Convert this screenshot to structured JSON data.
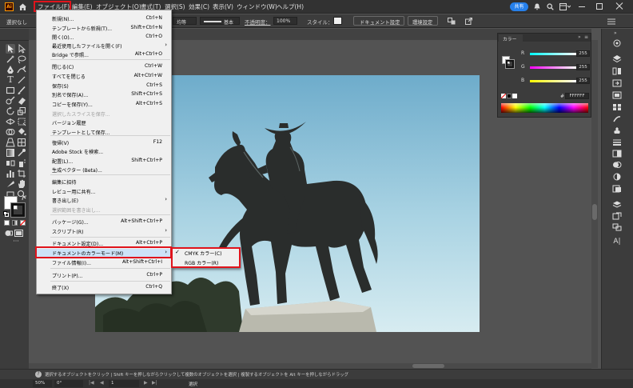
{
  "menubar": {
    "items": [
      "ファイル(F)",
      "編集(E)",
      "オブジェクト(O)",
      "書式(T)",
      "選択(S)",
      "効果(C)",
      "表示(V)",
      "ウィンドウ(W)",
      "ヘルプ(H)"
    ],
    "share_label": "共有"
  },
  "control_bar": {
    "selection_label": "選択なし",
    "stroke_profile": "均等",
    "brush_label": "基本",
    "opacity_label": "不透明度：",
    "opacity_value": "100%",
    "style_label": "スタイル：",
    "document_setup_button": "ドキュメント設定",
    "preferences_button": "環境設定"
  },
  "file_menu": {
    "items": [
      {
        "label": "新規(N)...",
        "shortcut": "Ctrl+N"
      },
      {
        "label": "テンプレートから新規(T)...",
        "shortcut": "Shift+Ctrl+N"
      },
      {
        "label": "開く(O)...",
        "shortcut": "Ctrl+O"
      },
      {
        "label": "最近使用したファイルを開く(F)",
        "shortcut": ""
      },
      {
        "label": "Bridge で参照...",
        "shortcut": "Alt+Ctrl+O"
      },
      {
        "label": "閉じる(C)",
        "shortcut": "Ctrl+W"
      },
      {
        "label": "すべてを閉じる",
        "shortcut": "Alt+Ctrl+W"
      },
      {
        "label": "保存(S)",
        "shortcut": "Ctrl+S"
      },
      {
        "label": "別名で保存(A)...",
        "shortcut": "Shift+Ctrl+S"
      },
      {
        "label": "コピーを保存(Y)...",
        "shortcut": "Alt+Ctrl+S"
      },
      {
        "label": "選択したスライスを保存...",
        "shortcut": ""
      },
      {
        "label": "バージョン履歴",
        "shortcut": ""
      },
      {
        "label": "テンプレートとして保存...",
        "shortcut": ""
      },
      {
        "label": "復帰(V)",
        "shortcut": "F12"
      },
      {
        "label": "Adobe Stock を検索...",
        "shortcut": ""
      },
      {
        "label": "配置(L)...",
        "shortcut": "Shift+Ctrl+P"
      },
      {
        "label": "生成ベクター (Beta)...",
        "shortcut": ""
      },
      {
        "label": "編集に招待",
        "shortcut": ""
      },
      {
        "label": "レビュー用に共有...",
        "shortcut": ""
      },
      {
        "label": "書き出し(E)",
        "shortcut": ""
      },
      {
        "label": "選択範囲を書き出し...",
        "shortcut": ""
      },
      {
        "label": "パッケージ(G)...",
        "shortcut": "Alt+Shift+Ctrl+P"
      },
      {
        "label": "スクリプト(R)",
        "shortcut": ""
      },
      {
        "label": "ドキュメント設定(D)...",
        "shortcut": "Alt+Ctrl+P"
      },
      {
        "label": "ドキュメントのカラーモード(M)",
        "shortcut": ""
      },
      {
        "label": "ファイル情報(I)...",
        "shortcut": "Alt+Shift+Ctrl+I"
      },
      {
        "label": "プリント(P)...",
        "shortcut": "Ctrl+P"
      },
      {
        "label": "終了(X)",
        "shortcut": "Ctrl+Q"
      }
    ]
  },
  "color_mode_submenu": {
    "items": [
      {
        "label": "CMYK カラー(C)",
        "checked": true
      },
      {
        "label": "RGB カラー(R)",
        "checked": false
      }
    ]
  },
  "color_panel": {
    "title": "カラー",
    "channels": [
      {
        "name": "R",
        "value": "255"
      },
      {
        "name": "G",
        "value": "255"
      },
      {
        "name": "B",
        "value": "255"
      }
    ],
    "hex_prefix": "#",
    "hex": "FFFFFF"
  },
  "status_bar": {
    "hint": "選択するオブジェクトをクリック | Shift キーを押しながらクリックして複数のオブジェクトを選択 | 複製するオブジェクトを Alt キーを押しながらドラッグ"
  },
  "bottom_bar": {
    "zoom": "50%",
    "rotation": "0°",
    "artboard_number": "1",
    "mode_label": "選択"
  },
  "colors": {
    "highlight_red": "#e0141c",
    "menu_bg": "#f0f0f0",
    "share_button": "#2680eb"
  }
}
